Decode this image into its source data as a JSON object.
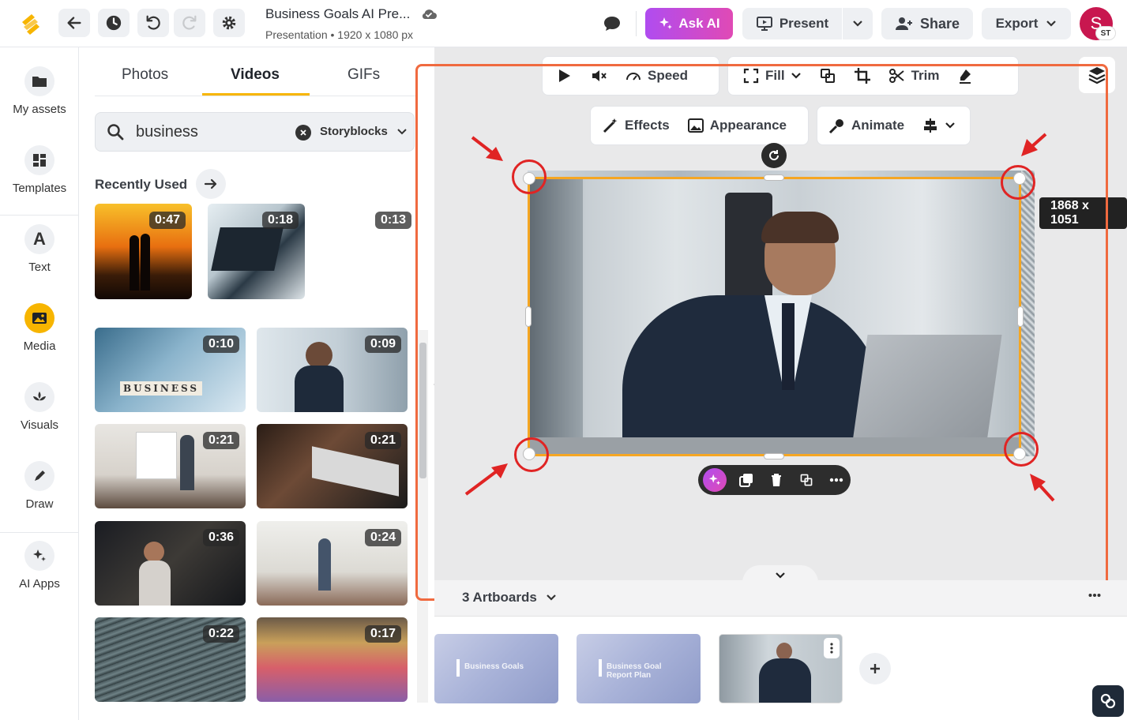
{
  "header": {
    "title": "Business Goals AI Pre...",
    "subtitle": "Presentation • 1920 x 1080 px",
    "ask_ai": "Ask AI",
    "present": "Present",
    "share": "Share",
    "export": "Export",
    "avatar_initial": "S",
    "avatar_badge": "ST"
  },
  "nav": {
    "items": [
      {
        "label": "My assets",
        "icon": "folder-icon"
      },
      {
        "label": "Templates",
        "icon": "templates-icon"
      },
      {
        "label": "Text",
        "icon": "text-icon"
      },
      {
        "label": "Media",
        "icon": "media-icon"
      },
      {
        "label": "Visuals",
        "icon": "visuals-icon"
      },
      {
        "label": "Draw",
        "icon": "pen-icon"
      },
      {
        "label": "AI Apps",
        "icon": "sparkle-icon"
      }
    ]
  },
  "panel": {
    "tabs": [
      "Photos",
      "Videos",
      "GIFs"
    ],
    "search_value": "business",
    "source": "Storyblocks",
    "recently_used": "Recently Used",
    "recent_durations": [
      "0:47",
      "0:18",
      "0:13"
    ],
    "grid_durations": [
      "0:10",
      "0:09",
      "0:21",
      "0:21",
      "0:36",
      "0:24",
      "0:22",
      "0:17"
    ],
    "business_tiles": "BUSINESS"
  },
  "canvas": {
    "toolbar1": {
      "speed": "Speed",
      "fill": "Fill",
      "trim": "Trim"
    },
    "toolbar2": {
      "effects": "Effects",
      "appearance": "Appearance",
      "animate": "Animate"
    },
    "size_tag": "1868 x 1051"
  },
  "artboards": {
    "label": "3 Artboards",
    "slides": [
      {
        "title": "Business Goals"
      },
      {
        "title": "Business Goal Report Plan"
      },
      {
        "title": ""
      }
    ]
  },
  "colors": {
    "accent": "#f7b500",
    "selection": "#f5a623",
    "annotation": "#e02424",
    "askai_start": "#b04cf0",
    "askai_end": "#e04ab5"
  }
}
